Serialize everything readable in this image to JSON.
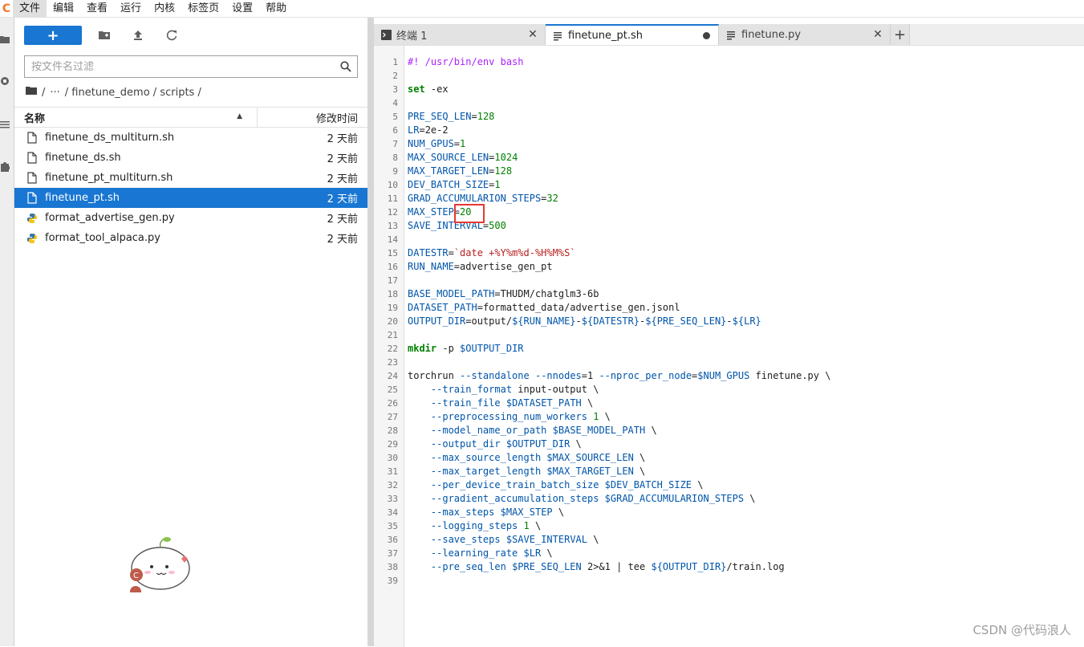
{
  "menubar": {
    "items": [
      "文件",
      "编辑",
      "查看",
      "运行",
      "内核",
      "标签页",
      "设置",
      "帮助"
    ],
    "active_index": 0
  },
  "filebrowser": {
    "new_button": "+",
    "search_placeholder": "按文件名过滤",
    "breadcrumb": [
      "/",
      "···",
      "/ finetune_demo / scripts /"
    ],
    "header": {
      "name": "名称",
      "modified": "修改时间"
    },
    "files": [
      {
        "name": "finetune_ds_multiturn.sh",
        "modified": "2 天前",
        "type": "file",
        "selected": false
      },
      {
        "name": "finetune_ds.sh",
        "modified": "2 天前",
        "type": "file",
        "selected": false
      },
      {
        "name": "finetune_pt_multiturn.sh",
        "modified": "2 天前",
        "type": "file",
        "selected": false
      },
      {
        "name": "finetune_pt.sh",
        "modified": "2 天前",
        "type": "file",
        "selected": true
      },
      {
        "name": "format_advertise_gen.py",
        "modified": "2 天前",
        "type": "python",
        "selected": false
      },
      {
        "name": "format_tool_alpaca.py",
        "modified": "2 天前",
        "type": "python",
        "selected": false
      }
    ]
  },
  "tabs": [
    {
      "label": "终端 1",
      "icon": "terminal-icon",
      "active": false,
      "dirty": false
    },
    {
      "label": "finetune_pt.sh",
      "icon": "text-file-icon",
      "active": true,
      "dirty": true
    },
    {
      "label": "finetune.py",
      "icon": "text-file-icon",
      "active": false,
      "dirty": false
    }
  ],
  "code_lines": [
    "#! /usr/bin/env bash",
    "",
    "set -ex",
    "",
    "PRE_SEQ_LEN=128",
    "LR=2e-2",
    "NUM_GPUS=1",
    "MAX_SOURCE_LEN=1024",
    "MAX_TARGET_LEN=128",
    "DEV_BATCH_SIZE=1",
    "GRAD_ACCUMULARION_STEPS=32",
    "MAX_STEP=20",
    "SAVE_INTERVAL=500",
    "",
    "DATESTR=`date +%Y%m%d-%H%M%S`",
    "RUN_NAME=advertise_gen_pt",
    "",
    "BASE_MODEL_PATH=THUDM/chatglm3-6b",
    "DATASET_PATH=formatted_data/advertise_gen.jsonl",
    "OUTPUT_DIR=output/${RUN_NAME}-${DATESTR}-${PRE_SEQ_LEN}-${LR}",
    "",
    "mkdir -p $OUTPUT_DIR",
    "",
    "torchrun --standalone --nnodes=1 --nproc_per_node=$NUM_GPUS finetune.py \\",
    "    --train_format input-output \\",
    "    --train_file $DATASET_PATH \\",
    "    --preprocessing_num_workers 1 \\",
    "    --model_name_or_path $BASE_MODEL_PATH \\",
    "    --output_dir $OUTPUT_DIR \\",
    "    --max_source_length $MAX_SOURCE_LEN \\",
    "    --max_target_length $MAX_TARGET_LEN \\",
    "    --per_device_train_batch_size $DEV_BATCH_SIZE \\",
    "    --gradient_accumulation_steps $GRAD_ACCUMULARION_STEPS \\",
    "    --max_steps $MAX_STEP \\",
    "    --logging_steps 1 \\",
    "    --save_steps $SAVE_INTERVAL \\",
    "    --learning_rate $LR \\",
    "    --pre_seq_len $PRE_SEQ_LEN 2>&1 | tee ${OUTPUT_DIR}/train.log",
    ""
  ],
  "watermark": "CSDN @代码浪人",
  "colors": {
    "accent": "#1976d2",
    "highlight_box": "#e53935"
  }
}
